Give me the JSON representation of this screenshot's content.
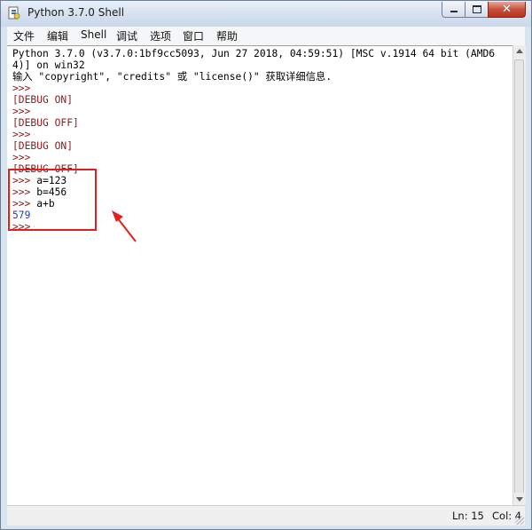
{
  "window": {
    "title": "Python 3.7.0 Shell",
    "close_glyph": "✕"
  },
  "menu": [
    "文件",
    "编辑",
    "Shell",
    "调试",
    "选项",
    "窗口",
    "帮助"
  ],
  "shell_lines": [
    {
      "text": "Python 3.7.0 (v3.7.0:1bf9cc5093, Jun 27 2018, 04:59:51) [MSC v.1914 64 bit (AMD6",
      "kind": "output"
    },
    {
      "text": "4)] on win32",
      "kind": "output"
    },
    {
      "text": "输入 \"copyright\", \"credits\" 或 \"license()\" 获取详细信息.",
      "kind": "output"
    },
    {
      "text": ">>>",
      "kind": "prompt"
    },
    {
      "text": "[DEBUG ON]",
      "kind": "prompt"
    },
    {
      "text": ">>>",
      "kind": "prompt"
    },
    {
      "text": "[DEBUG OFF]",
      "kind": "prompt"
    },
    {
      "text": ">>>",
      "kind": "prompt"
    },
    {
      "text": "[DEBUG ON]",
      "kind": "prompt"
    },
    {
      "text": ">>>",
      "kind": "prompt"
    },
    {
      "text": "[DEBUG OFF]",
      "kind": "prompt"
    },
    {
      "text": ">>> ",
      "kind": "prompt",
      "input": "a=123"
    },
    {
      "text": ">>> ",
      "kind": "prompt",
      "input": "b=456"
    },
    {
      "text": ">>> ",
      "kind": "prompt",
      "input": "a+b"
    },
    {
      "text": "579",
      "kind": "stdout"
    },
    {
      "text": ">>>",
      "kind": "prompt"
    }
  ],
  "status": {
    "ln": "Ln: 15",
    "col": "Col: 4"
  },
  "colors": {
    "prompt": "#8b1a1a",
    "stdout": "#1e3fb5",
    "annotation": "#e21f1f"
  }
}
